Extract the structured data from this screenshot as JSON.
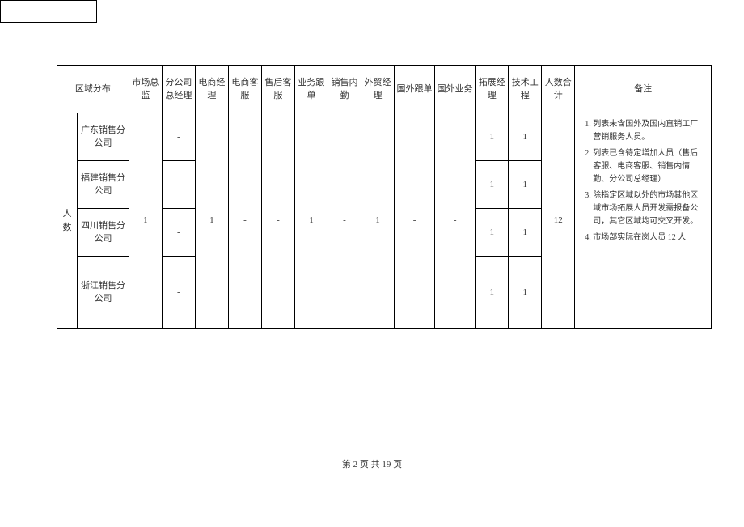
{
  "headers": {
    "region_dist": "区域分布",
    "market_dir": "市场总监",
    "branch_gm": "分公司总经理",
    "ecom_mgr": "电商经理",
    "ecom_cs": "电商客服",
    "aftersale_cs": "售后客服",
    "biz_follow": "业务跟单",
    "sales_clerk": "销售内勤",
    "foreign_mgr": "外贸经理",
    "intl_follow": "国外跟单",
    "intl_biz": "国外业务",
    "expand_mgr": "拓展经理",
    "tech_eng": "技术工程",
    "total": "人数合计",
    "remarks": "备注"
  },
  "rowgroup_label": "人数",
  "rows": [
    {
      "region": "广东销售分公司",
      "branch_gm": "-",
      "expand_mgr": "1",
      "tech_eng": "1"
    },
    {
      "region": "福建销售分公司",
      "branch_gm": "-",
      "expand_mgr": "1",
      "tech_eng": "1"
    },
    {
      "region": "四川销售分公司",
      "branch_gm": "-",
      "expand_mgr": "1",
      "tech_eng": "1"
    },
    {
      "region": "浙江销售分公司",
      "branch_gm": "-",
      "expand_mgr": "1",
      "tech_eng": "1"
    }
  ],
  "shared": {
    "market_dir": "1",
    "ecom_mgr": "1",
    "ecom_cs": "-",
    "aftersale_cs": "-",
    "biz_follow": "1",
    "sales_clerk": "-",
    "foreign_mgr": "1",
    "intl_follow": "-",
    "intl_biz": "-",
    "total": "12"
  },
  "remarks_list": [
    "列表未含国外及国内直销工厂营销服务人员。",
    "列表已含待定增加人员（售后客服、电商客服、销售内情勤、分公司总经理）",
    "除指定区域以外的市场其他区域市场拓展人员开发需报备公司，其它区域均可交叉开发。",
    "市场部实际在岗人员 12 人"
  ],
  "footer": "第 2 页 共 19 页"
}
